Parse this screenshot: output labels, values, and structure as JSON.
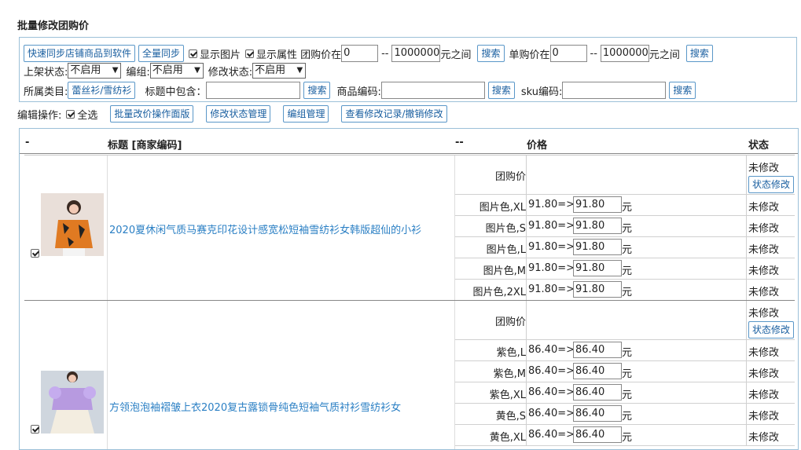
{
  "page": {
    "title": "批量修改团购价"
  },
  "filters": {
    "quick_sync_label": "快速同步店铺商品到软件",
    "full_sync_label": "全量同步",
    "show_image_label": "显示图片",
    "show_attr_label": "显示属性",
    "group_price_label": "团购价在",
    "group_price_min": "0",
    "range_sep": "--",
    "group_price_max": "1000000",
    "between_label": "元之间",
    "search_label": "搜索",
    "unit_price_label": "单购价在",
    "unit_price_min": "0",
    "unit_price_max": "1000000",
    "listing_label": "上架状态:",
    "listing_value": "不启用",
    "group_label": "编组:",
    "group_value": "不启用",
    "modify_label": "修改状态:",
    "modify_value": "不启用",
    "category_label": "所属类目:",
    "category_value": "蕾丝衫/雪纺衫",
    "title_contains_label": "标题中包含：",
    "product_code_label": "商品编码:",
    "sku_code_label": "sku编码:"
  },
  "ops": {
    "label": "编辑操作:",
    "select_all_label": "全选",
    "batch_panel_label": "批量改价操作面版",
    "status_mgmt_label": "修改状态管理",
    "group_mgmt_label": "编组管理",
    "history_label": "查看修改记录/撤销修改"
  },
  "table": {
    "col_dash": "-",
    "col_title": "标题 [商家编码]",
    "col_sep": "--",
    "col_price": "价格",
    "col_status": "状态"
  },
  "products": [
    {
      "title": "2020夏休闲气质马赛克印花设计感宽松短袖雪纺衫女韩版超仙的小衫",
      "group_label": "团购价",
      "group_status": "未修改",
      "status_btn": "状态修改",
      "arrow": "=>",
      "unit": "元",
      "variants": [
        {
          "name": "图片色,XL",
          "old": "91.80",
          "new": "91.80",
          "status": "未修改"
        },
        {
          "name": "图片色,S",
          "old": "91.80",
          "new": "91.80",
          "status": "未修改"
        },
        {
          "name": "图片色,L",
          "old": "91.80",
          "new": "91.80",
          "status": "未修改"
        },
        {
          "name": "图片色,M",
          "old": "91.80",
          "new": "91.80",
          "status": "未修改"
        },
        {
          "name": "图片色,2XL",
          "old": "91.80",
          "new": "91.80",
          "status": "未修改"
        }
      ]
    },
    {
      "title": "方领泡泡袖褶皱上衣2020复古露锁骨纯色短袖气质衬衫雪纺衫女",
      "group_label": "团购价",
      "group_status": "未修改",
      "status_btn": "状态修改",
      "arrow": "=>",
      "unit": "元",
      "variants": [
        {
          "name": "紫色,L",
          "old": "86.40",
          "new": "86.40",
          "status": "未修改"
        },
        {
          "name": "紫色,M",
          "old": "86.40",
          "new": "86.40",
          "status": "未修改"
        },
        {
          "name": "紫色,XL",
          "old": "86.40",
          "new": "86.40",
          "status": "未修改"
        },
        {
          "name": "黄色,S",
          "old": "86.40",
          "new": "86.40",
          "status": "未修改"
        },
        {
          "name": "黄色,XL",
          "old": "86.40",
          "new": "86.40",
          "status": "未修改"
        }
      ]
    }
  ]
}
